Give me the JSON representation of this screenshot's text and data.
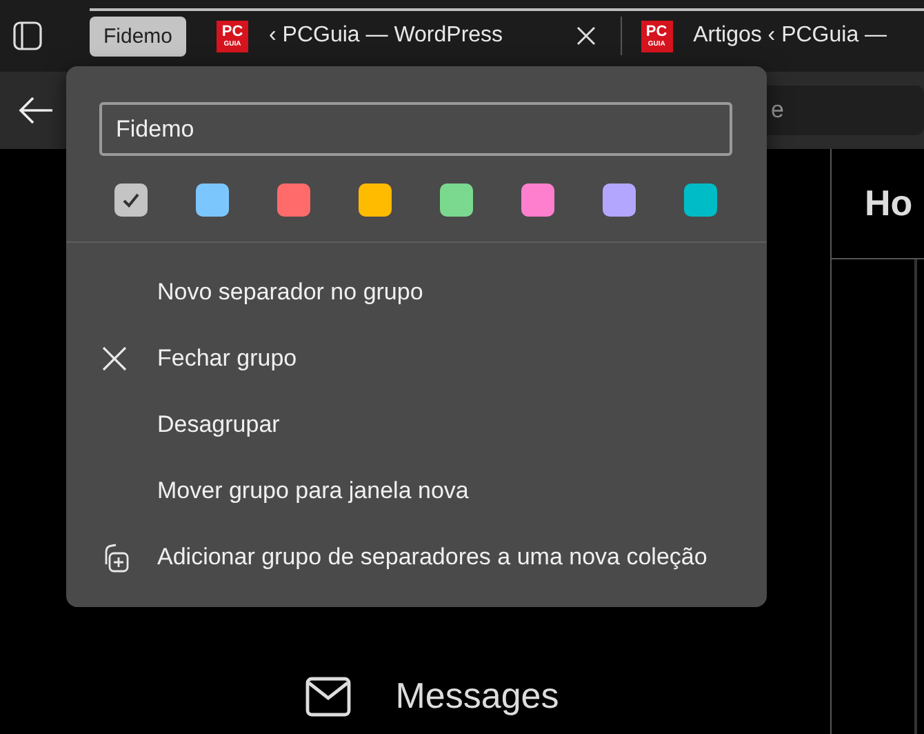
{
  "tab_bar": {
    "group": {
      "label": "Fidemo"
    },
    "tabs": [
      {
        "title": "‹ PCGuia — WordPress",
        "favicon": "PC",
        "favicon_sub": "GUIA",
        "closable": true
      },
      {
        "title": "Artigos ‹ PCGuia —",
        "favicon": "PC",
        "favicon_sub": "GUIA",
        "closable": false
      }
    ]
  },
  "address_bar": {
    "text_fragment": "e"
  },
  "page": {
    "heading_fragment": "Ho",
    "nav_item": "Messages"
  },
  "group_menu": {
    "name_field": {
      "value": "Fidemo"
    },
    "colors": [
      {
        "color": "#c4c4c4",
        "selected": true
      },
      {
        "color": "#7cc6fe",
        "selected": false
      },
      {
        "color": "#ff6b6b",
        "selected": false
      },
      {
        "color": "#ffbb00",
        "selected": false
      },
      {
        "color": "#7ad98f",
        "selected": false
      },
      {
        "color": "#ff7fcf",
        "selected": false
      },
      {
        "color": "#b3a6ff",
        "selected": false
      },
      {
        "color": "#00bcc7",
        "selected": false
      }
    ],
    "items": [
      {
        "label": "Novo separador no grupo",
        "kind": "plain"
      },
      {
        "label": "Fechar grupo",
        "kind": "close"
      },
      {
        "label": "Desagrupar",
        "kind": "plain"
      },
      {
        "label": "Mover grupo para janela nova",
        "kind": "plain"
      },
      {
        "label": "Adicionar grupo de separadores a uma nova coleção",
        "kind": "collection"
      }
    ]
  }
}
